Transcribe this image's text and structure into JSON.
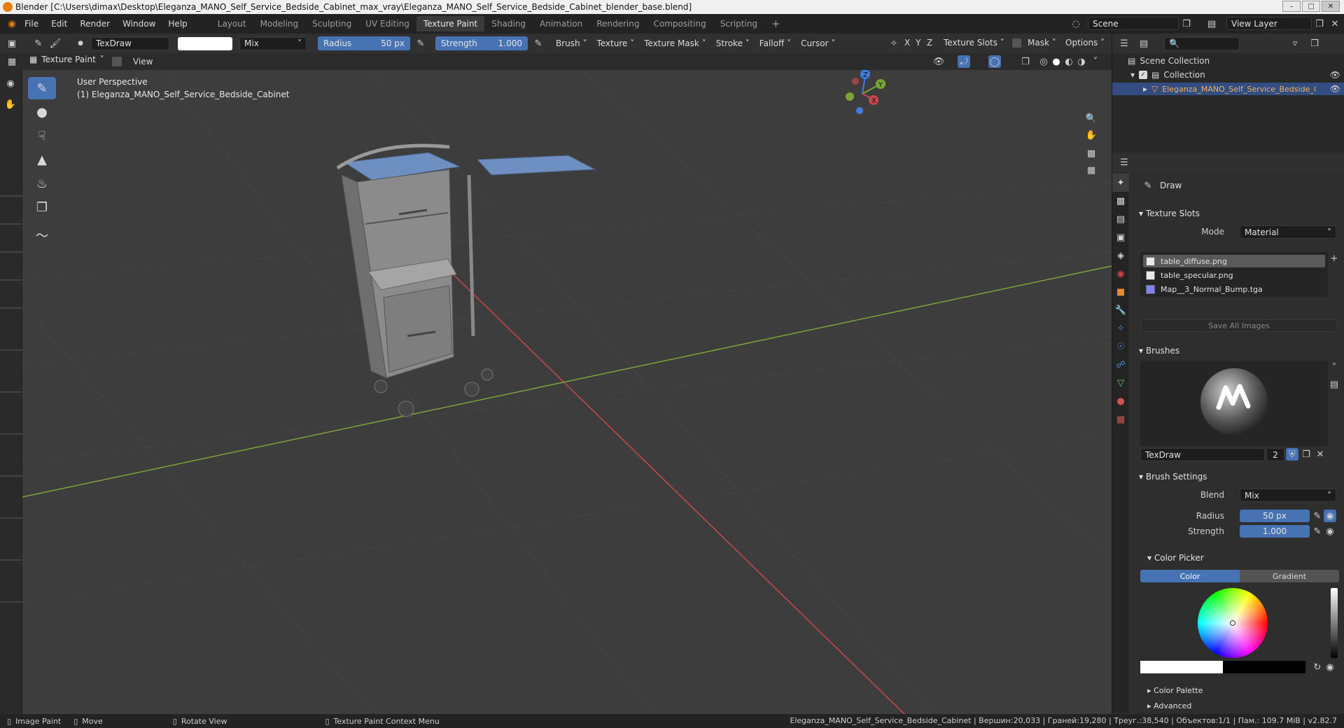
{
  "titlebar": {
    "title": "Blender [C:\\Users\\dimax\\Desktop\\Eleganza_MANO_Self_Service_Bedside_Cabinet_max_vray\\Eleganza_MANO_Self_Service_Bedside_Cabinet_blender_base.blend]"
  },
  "menubar": {
    "menus": [
      "File",
      "Edit",
      "Render",
      "Window",
      "Help"
    ],
    "workspaces": [
      "Layout",
      "Modeling",
      "Sculpting",
      "UV Editing",
      "Texture Paint",
      "Shading",
      "Animation",
      "Rendering",
      "Compositing",
      "Scripting"
    ],
    "active_workspace": "Texture Paint",
    "add": "+",
    "scene": "Scene",
    "view_layer": "View Layer"
  },
  "toolhdr": {
    "brush_name": "TexDraw",
    "blend": "Mix",
    "radius_label": "Radius",
    "radius_value": "50 px",
    "strength_label": "Strength",
    "strength_value": "1.000",
    "menus": [
      "Brush",
      "Texture",
      "Texture Mask",
      "Stroke",
      "Falloff",
      "Cursor"
    ],
    "axes": [
      "X",
      "Y",
      "Z"
    ],
    "texture_slots": "Texture Slots",
    "mask": "Mask",
    "options": "Options"
  },
  "hdr2": {
    "mode": "Texture Paint",
    "view": "View"
  },
  "viewport": {
    "perspective": "User Perspective",
    "object": "(1) Eleganza_MANO_Self_Service_Bedside_Cabinet",
    "gizmo": {
      "z": "Z",
      "y": "Y",
      "x": "X"
    }
  },
  "outliner": {
    "scene_collection": "Scene Collection",
    "collection": "Collection",
    "object": "Eleganza_MANO_Self_Service_Bedside_Cabi"
  },
  "props": {
    "tool_name": "Draw",
    "texture_slots": {
      "title": "Texture Slots",
      "mode_label": "Mode",
      "mode_value": "Material",
      "slots": [
        {
          "name": "table_diffuse.png",
          "color": "#e8e8e8"
        },
        {
          "name": "table_specular.png",
          "color": "#e8e8e8"
        },
        {
          "name": "Map__3_Normal_Bump.tga",
          "color": "#8080ff"
        }
      ],
      "save_all": "Save All Images"
    },
    "brushes": {
      "title": "Brushes",
      "brush_name": "TexDraw",
      "users": "2"
    },
    "brush_settings": {
      "title": "Brush Settings",
      "blend_label": "Blend",
      "blend_value": "Mix",
      "radius_label": "Radius",
      "radius_value": "50 px",
      "strength_label": "Strength",
      "strength_value": "1.000"
    },
    "color_picker": {
      "title": "Color Picker",
      "tab_color": "Color",
      "tab_gradient": "Gradient"
    },
    "color_palette": "Color Palette",
    "advanced": "Advanced"
  },
  "status": {
    "items": [
      "Image Paint",
      "Move",
      "Rotate View",
      "Texture Paint Context Menu"
    ],
    "stats": "Eleganza_MANO_Self_Service_Bedside_Cabinet | Вершин:20,033 | Граней:19,280 | Треуг.:38,540 | Объектов:1/1 | Пам.: 109.7 MiB | v2.82.7"
  },
  "colors": {
    "accent": "#4772b3",
    "viewport_bg": "#3d3d3d",
    "panel_bg": "#2e2e2e",
    "axis_x": "#c8484a",
    "axis_y": "#7ca435",
    "model_blue": "#6d8fc2"
  }
}
